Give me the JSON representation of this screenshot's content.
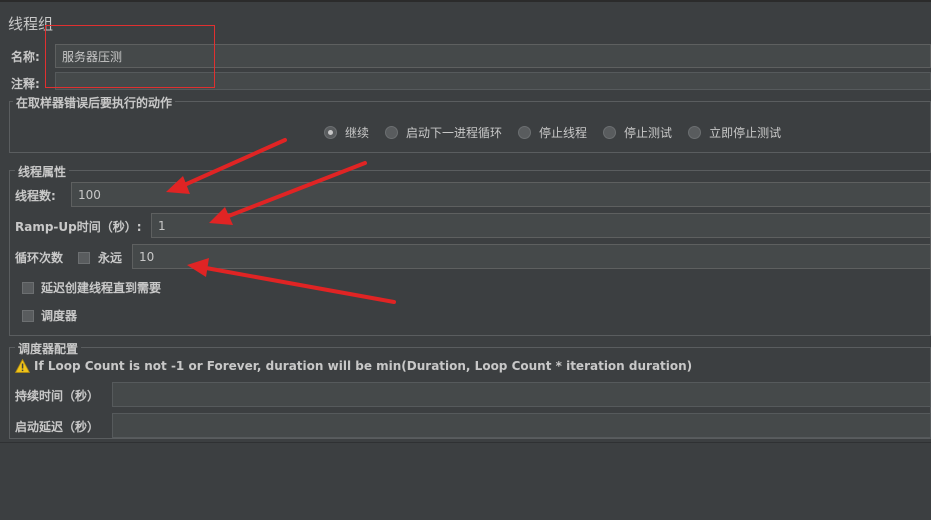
{
  "window": {
    "title": "线程组"
  },
  "name_row": {
    "label": "名称:",
    "value": "服务器压测"
  },
  "comment_row": {
    "label": "注释:",
    "value": ""
  },
  "error_action": {
    "legend": "在取样器错误后要执行的动作",
    "options": [
      {
        "label": "继续",
        "selected": true
      },
      {
        "label": "启动下一进程循环",
        "selected": false
      },
      {
        "label": "停止线程",
        "selected": false
      },
      {
        "label": "停止测试",
        "selected": false
      },
      {
        "label": "立即停止测试",
        "selected": false
      }
    ]
  },
  "thread_props": {
    "legend": "线程属性",
    "threads_label": "线程数:",
    "threads_value": "100",
    "rampup_label": "Ramp-Up时间（秒）:",
    "rampup_value": "1",
    "loop_label": "循环次数",
    "forever_label": "永远",
    "forever_checked": false,
    "loop_value": "10",
    "delay_label": "延迟创建线程直到需要",
    "delay_checked": false,
    "scheduler_label": "调度器",
    "scheduler_checked": false
  },
  "scheduler_config": {
    "legend": "调度器配置",
    "warning": "If Loop Count is not -1 or Forever, duration will be min(Duration, Loop Count * iteration duration)",
    "duration_label": "持续时间（秒）",
    "duration_value": "",
    "startup_delay_label": "启动延迟（秒）",
    "startup_delay_value": ""
  },
  "colors": {
    "background": "#3c3f41",
    "field": "#45494a",
    "annotation_red": "#e02424",
    "warning_yellow": "#f0c419"
  }
}
